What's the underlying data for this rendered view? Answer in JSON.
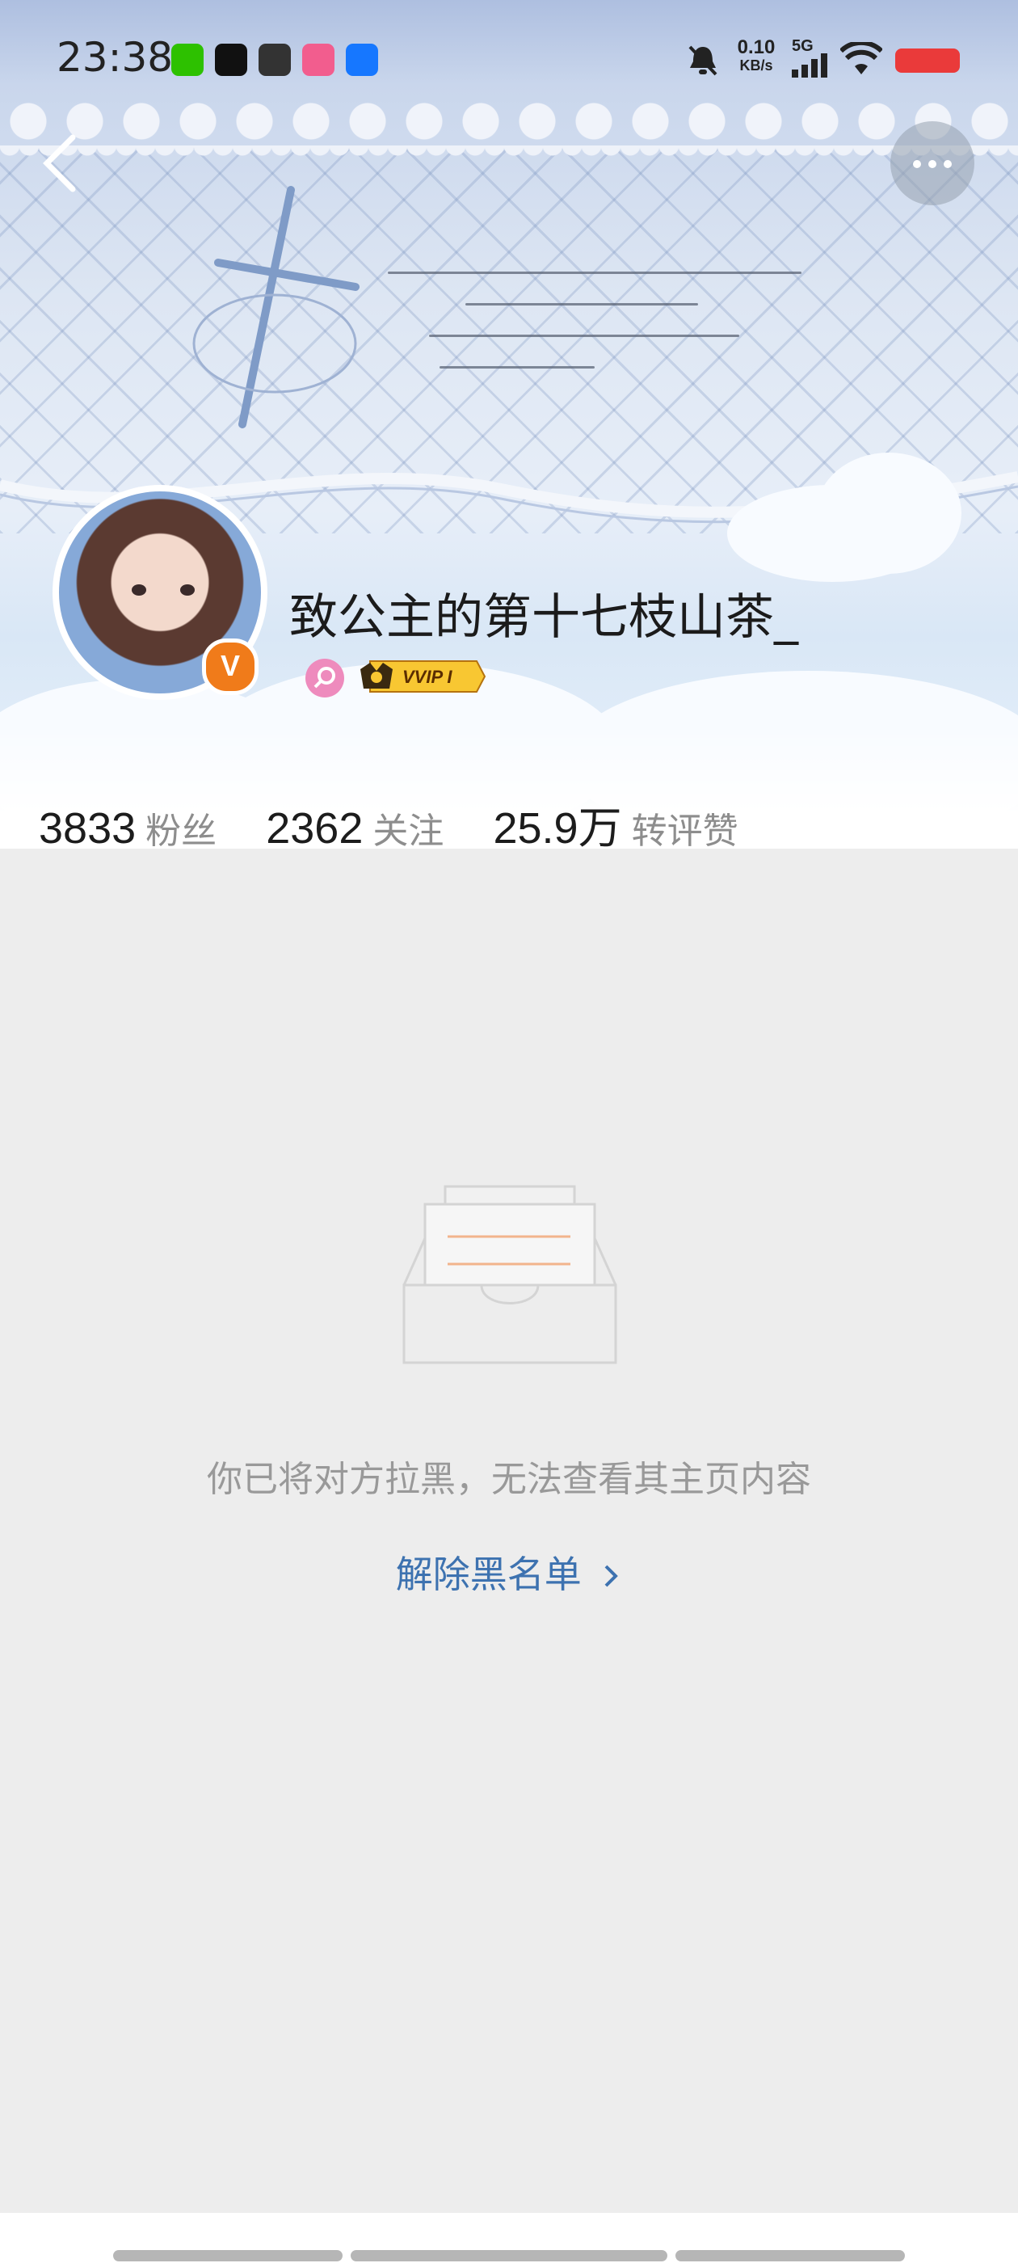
{
  "status_bar": {
    "time": "23:38",
    "net_speed_value": "0.10",
    "net_speed_unit": "KB/s",
    "network": "5G",
    "notification_apps": [
      "wechat-icon",
      "tiktok-icon",
      "app-icon",
      "bilibili-icon",
      "browser-icon"
    ]
  },
  "nav": {
    "back_icon": "chevron-left-icon",
    "more_icon": "more-horizontal-icon"
  },
  "profile": {
    "name": "致公主的第十七枝山茶_",
    "verified_badge": "V",
    "vip_label": "VVIP I"
  },
  "stats": [
    {
      "value": "3833",
      "label": "粉丝"
    },
    {
      "value": "2362",
      "label": "关注"
    },
    {
      "value": "25.9万",
      "label": "转评赞"
    }
  ],
  "blocked": {
    "message": "你已将对方拉黑，无法查看其主页内容",
    "unblock_label": "解除黑名单"
  },
  "colors": {
    "accent_link": "#3d72b0",
    "verified_orange": "#f07b1a",
    "page_bg": "#ededed"
  }
}
